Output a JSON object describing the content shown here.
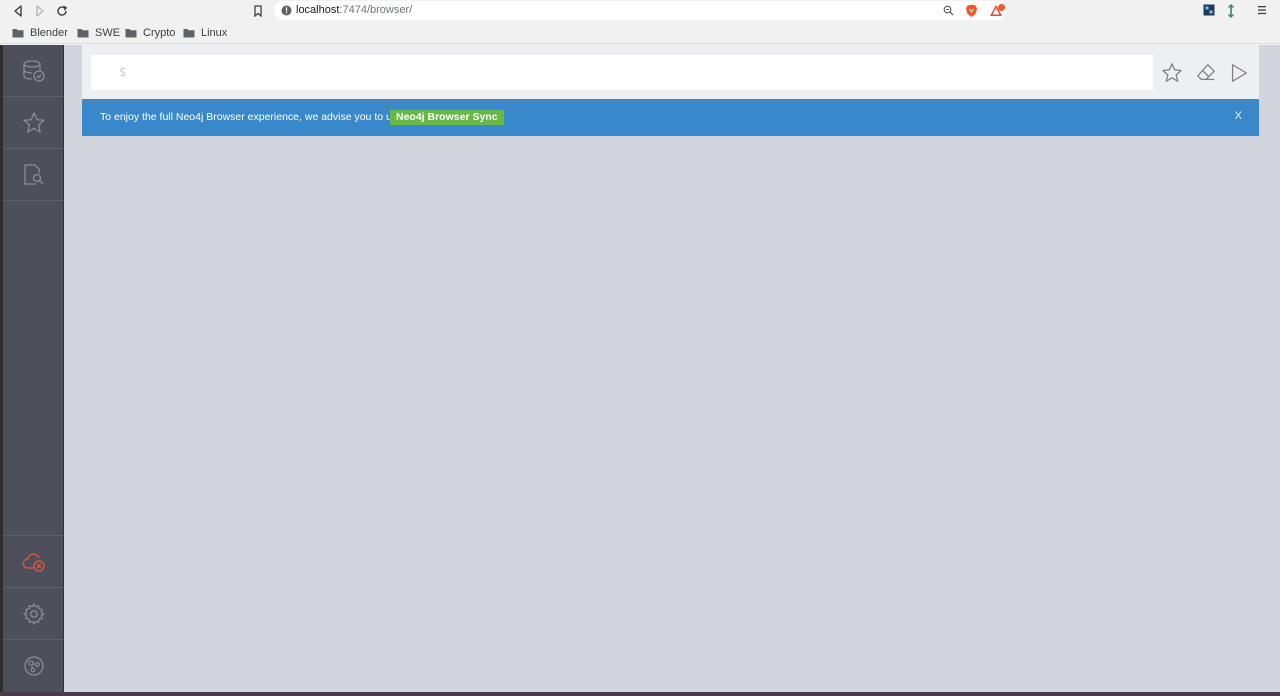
{
  "browser": {
    "url_host": "localhost",
    "url_path": ":7474/browser/",
    "bookmarks": [
      {
        "label": "Blender"
      },
      {
        "label": "SWE"
      },
      {
        "label": "Crypto"
      },
      {
        "label": "Linux"
      }
    ]
  },
  "editor": {
    "prompt": "$",
    "value": ""
  },
  "banner": {
    "message": "To enjoy the full Neo4j Browser experience, we advise you to use",
    "button_label": "Neo4j Browser Sync",
    "close_label": "X"
  },
  "sidebar": {
    "top_items": [
      {
        "icon": "database-icon"
      },
      {
        "icon": "star-icon"
      },
      {
        "icon": "document-search-icon"
      }
    ],
    "bottom_items": [
      {
        "icon": "cloud-disconnected-icon"
      },
      {
        "icon": "gear-icon"
      },
      {
        "icon": "neo4j-logo-icon"
      }
    ]
  },
  "colors": {
    "sidebar_bg": "#4d4f5b",
    "banner_bg": "#3a88cc",
    "sync_button_bg": "#68b845",
    "disconnected_red": "#e0513f",
    "content_bg": "#d2d5dd"
  }
}
